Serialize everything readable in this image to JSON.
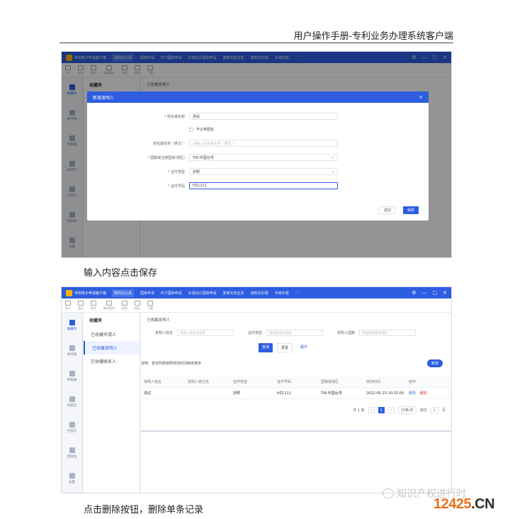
{
  "doc_header": "用户操作手册-专利业务办理系统客户端",
  "app": {
    "title": "专利电子申请客户端",
    "tabs": [
      "我的办公桌",
      "国家申请",
      "PCT国际申请",
      "外观设计国际申请",
      "复审无效业务",
      "通知书办理",
      "手续办理",
      "···"
    ],
    "window_controls": [
      "⚙",
      "—",
      "□",
      "✕"
    ],
    "toolbar": [
      "导入",
      "导出",
      "签名",
      "取消签名",
      "校验",
      "提交",
      "下载"
    ]
  },
  "sidebar": [
    "收藏夹",
    "收件箱",
    "草稿箱",
    "待提交",
    "已提交",
    "回收站",
    "设置"
  ],
  "subnav": {
    "title": "收藏夹",
    "items": [
      "已收藏申请人",
      "已收藏发明人",
      "已收藏联系人"
    ]
  },
  "shot1": {
    "breadcrumb": "已收藏发明人",
    "modal": {
      "title": "新增发明人",
      "close": "×",
      "fields": [
        {
          "label": "姓名或名称",
          "required": true,
          "value": "测试",
          "placeholder": ""
        },
        {
          "label": "不公布姓名",
          "required": false,
          "type": "checkbox"
        },
        {
          "label": "姓名或名称（英文）",
          "required": false,
          "value": "",
          "placeholder": "请输入姓名或名称（英文）"
        },
        {
          "label": "国籍或注册国家(地区)",
          "required": true,
          "value": "TW-中国台湾",
          "type": "select"
        },
        {
          "label": "证件类型",
          "required": true,
          "value": "护照",
          "type": "select"
        },
        {
          "label": "证件号码",
          "required": true,
          "value": "HZ1111",
          "focused": true
        }
      ],
      "back_label": "返回",
      "save_label": "保存"
    }
  },
  "caption1": "输入内容点击保存",
  "shot2": {
    "breadcrumb": "已收藏发明人",
    "filters": [
      {
        "label": "发明人姓名",
        "placeholder": "请输入姓名或名称"
      },
      {
        "label": "证件类型",
        "placeholder": "请选择证件类型"
      },
      {
        "label": "发明人国籍",
        "placeholder": "请选择国籍或地区"
      }
    ],
    "query_label": "查询",
    "reset_label": "重置",
    "more_label": "展开",
    "tip": "说明：查询列表按照修改时间倒序排序",
    "new_label": "新增",
    "columns": [
      "发明人姓名",
      "发明人英文名",
      "证件类型",
      "证件号码",
      "国籍或地区",
      "修改时间",
      "操作"
    ],
    "rows": [
      {
        "name": "测试",
        "en_name": "",
        "id_type": "护照",
        "id_no": "HZ1111",
        "country": "TW-中国台湾",
        "modified": "2022-05-23 10:32:00",
        "edit": "修改",
        "delete": "删除"
      }
    ],
    "pager": {
      "total": "共 1 条",
      "prev": "‹",
      "page": "1",
      "next": "›",
      "size": "10条/页",
      "goto": "前往",
      "goto_page": "1",
      "unit": "页"
    }
  },
  "caption2": "点击删除按钮，删除单条记录",
  "watermark": {
    "text": "知识产权进行时",
    "num": "12425",
    "cn": ".CN"
  },
  "colors": {
    "accent": "#2d5de0",
    "danger": "#e03b3b",
    "watermark_orange": "#e8701a"
  }
}
